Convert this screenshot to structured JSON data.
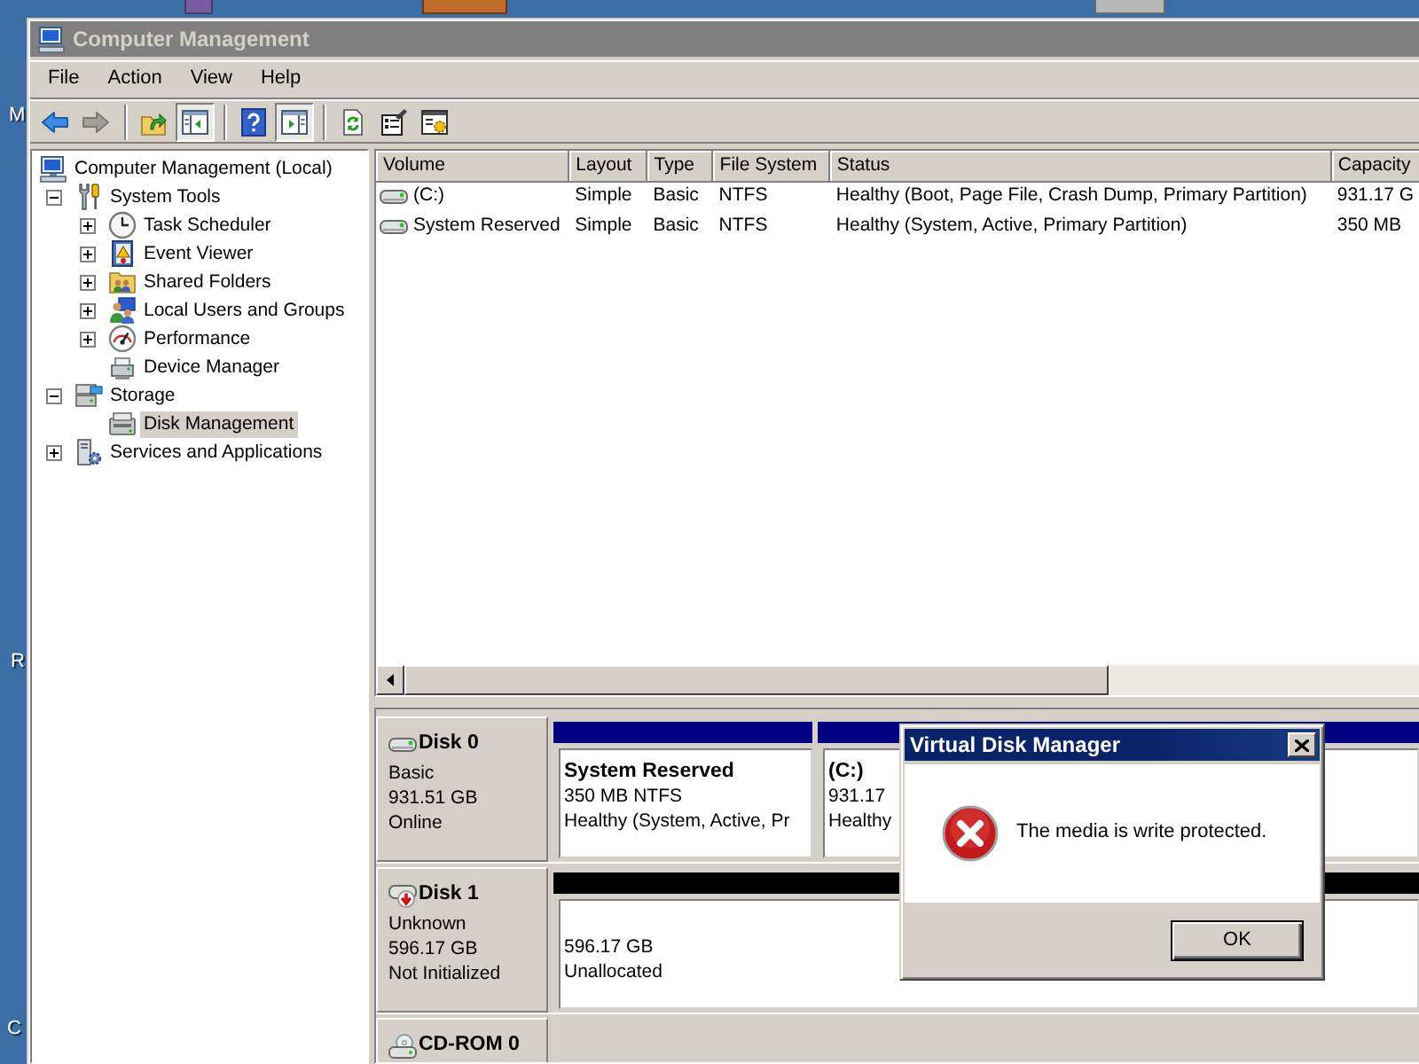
{
  "desktop": {
    "labels": [
      "M",
      "R",
      "C"
    ]
  },
  "window": {
    "title": "Computer Management",
    "active": false
  },
  "menu": [
    "File",
    "Action",
    "View",
    "Help"
  ],
  "toolbar": [
    [
      {
        "kind": "back",
        "disabled": false,
        "pressed": false
      },
      {
        "kind": "forward",
        "disabled": true,
        "pressed": false
      }
    ],
    [
      {
        "kind": "up",
        "disabled": false,
        "pressed": false
      },
      {
        "kind": "console-tree",
        "disabled": false,
        "pressed": true
      }
    ],
    [
      {
        "kind": "help",
        "disabled": false,
        "pressed": false
      },
      {
        "kind": "action-pane",
        "disabled": false,
        "pressed": true
      }
    ],
    [
      {
        "kind": "refresh",
        "disabled": false,
        "pressed": false
      },
      {
        "kind": "properties",
        "disabled": false,
        "pressed": false
      },
      {
        "kind": "tool",
        "disabled": false,
        "pressed": false
      }
    ]
  ],
  "tree": [
    {
      "label": "Computer Management (Local)",
      "kind": "computer",
      "selected": false,
      "children": [
        {
          "label": "System Tools",
          "kind": "tools",
          "expanded": true,
          "selected": false,
          "children": [
            {
              "label": "Task Scheduler",
              "kind": "scheduler",
              "expanded": false,
              "selected": false
            },
            {
              "label": "Event Viewer",
              "kind": "events",
              "expanded": false,
              "selected": false
            },
            {
              "label": "Shared Folders",
              "kind": "shares",
              "expanded": false,
              "selected": false
            },
            {
              "label": "Local Users and Groups",
              "kind": "users",
              "expanded": false,
              "selected": false
            },
            {
              "label": "Performance",
              "kind": "performance",
              "expanded": false,
              "selected": false
            },
            {
              "label": "Device Manager",
              "kind": "devices",
              "selected": false
            }
          ]
        },
        {
          "label": "Storage",
          "kind": "storage",
          "expanded": true,
          "selected": false,
          "children": [
            {
              "label": "Disk Management",
              "kind": "disks",
              "selected": true
            }
          ]
        },
        {
          "label": "Services and Applications",
          "kind": "services",
          "expanded": false,
          "selected": false
        }
      ]
    }
  ],
  "volumes": {
    "columns": [
      "Volume",
      "Layout",
      "Type",
      "File System",
      "Status",
      "Capacity"
    ],
    "rows": [
      {
        "cells": [
          "(C:)",
          "Simple",
          "Basic",
          "NTFS",
          "Healthy (Boot, Page File, Crash Dump, Primary Partition)",
          "931.17 G"
        ],
        "selected": false
      },
      {
        "cells": [
          "System Reserved",
          "Simple",
          "Basic",
          "NTFS",
          "Healthy (System, Active, Primary Partition)",
          "350 MB"
        ],
        "selected": false
      }
    ]
  },
  "disks": [
    {
      "kind": "basic",
      "name": "Disk 0",
      "lines": [
        "Basic",
        "931.51 GB",
        "Online"
      ],
      "partitions": [
        {
          "name": "System Reserved",
          "lines": [
            "350 MB NTFS",
            "Healthy (System, Active, Pr"
          ],
          "color": "#000080"
        },
        {
          "name": "(C:)",
          "lines": [
            "931.17",
            "Healthy"
          ],
          "color": "#000080"
        }
      ]
    },
    {
      "kind": "not-initialized",
      "name": "Disk 1",
      "lines": [
        "Unknown",
        "596.17 GB",
        "Not Initialized"
      ],
      "partitions": [
        {
          "lines": [
            "596.17 GB",
            "Unallocated"
          ],
          "color": "#000000"
        }
      ]
    },
    {
      "kind": "cdrom",
      "name": "CD-ROM 0"
    }
  ],
  "dialog": {
    "title": "Virtual Disk Manager",
    "active": true,
    "kind": "error",
    "message": "The media is write protected.",
    "buttons": [
      {
        "label": "OK",
        "default": true
      }
    ]
  }
}
